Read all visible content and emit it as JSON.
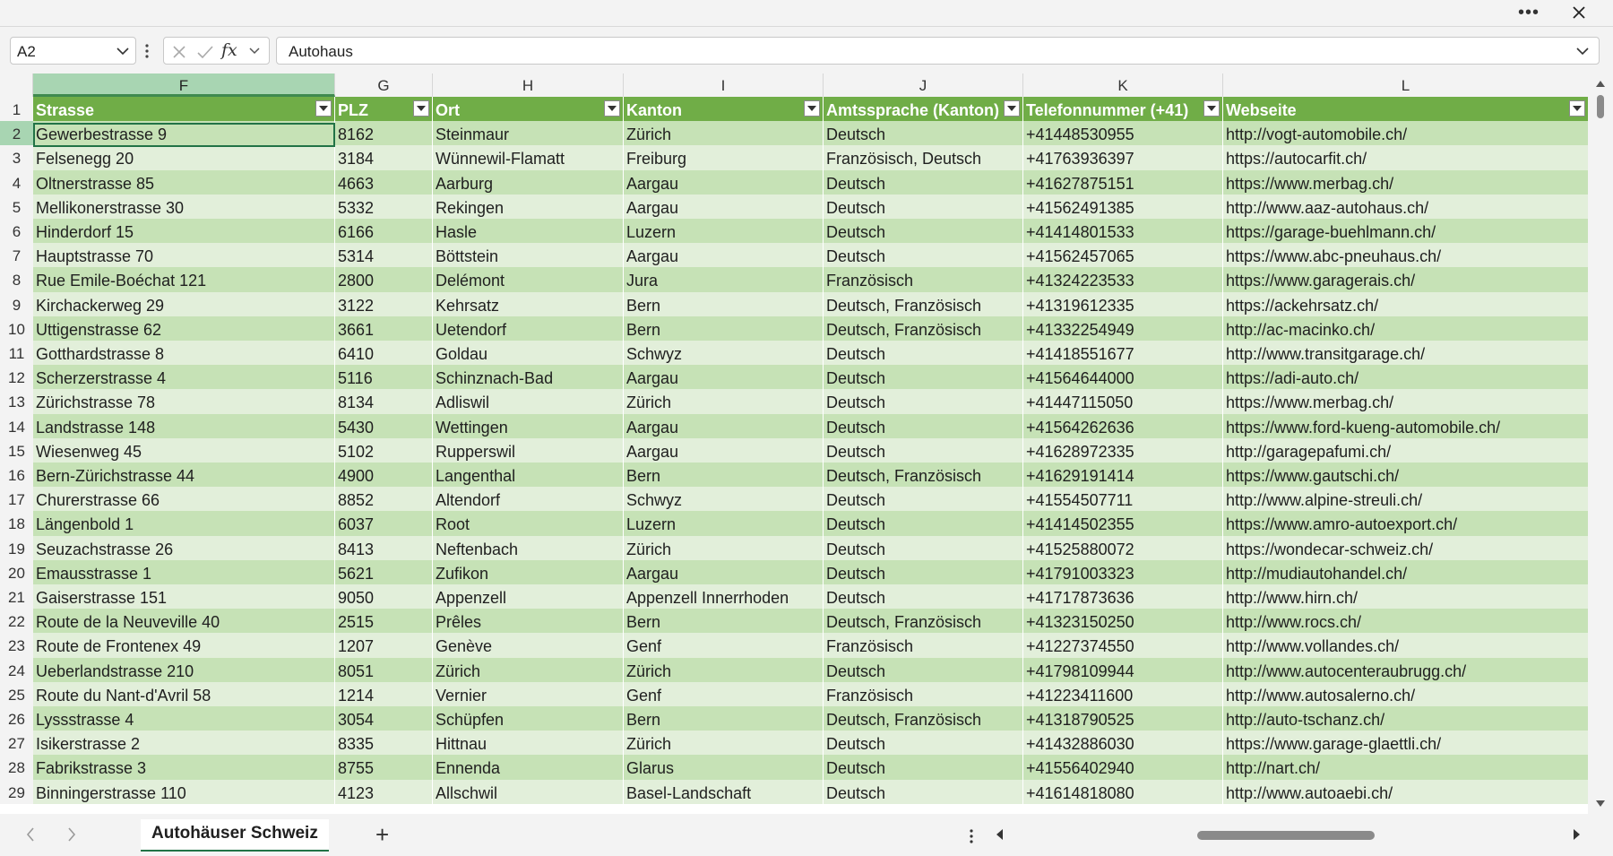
{
  "window": {
    "more_icon": "ellipsis-icon",
    "close_icon": "close-icon"
  },
  "formula_bar": {
    "name_box": "A2",
    "formula": "Autohaus",
    "fx_label": "fx"
  },
  "colors": {
    "header_fill": "#70ad47",
    "band_dark": "#c6e2b6",
    "band_light": "#e2efda",
    "selected_col": "#a8d5b2",
    "accent": "#217346"
  },
  "columns": [
    "F",
    "G",
    "H",
    "I",
    "J",
    "K",
    "L"
  ],
  "selected_column": "F",
  "table": {
    "headers": [
      "Strasse",
      "PLZ",
      "Ort",
      "Kanton",
      "Amtssprache (Kanton)",
      "Telefonnummer (+41)",
      "Webseite"
    ],
    "rows": [
      [
        "Gewerbestrasse 9",
        "8162",
        "Steinmaur",
        "Zürich",
        "Deutsch",
        "+41448530955",
        "http://vogt-automobile.ch/"
      ],
      [
        "Felsenegg 20",
        "3184",
        "Wünnewil-Flamatt",
        "Freiburg",
        "Französisch, Deutsch",
        "+41763936397",
        "https://autocarfit.ch/"
      ],
      [
        "Oltnerstrasse 85",
        "4663",
        "Aarburg",
        "Aargau",
        "Deutsch",
        "+41627875151",
        "https://www.merbag.ch/"
      ],
      [
        "Mellikonerstrasse 30",
        "5332",
        "Rekingen",
        "Aargau",
        "Deutsch",
        "+41562491385",
        "http://www.aaz-autohaus.ch/"
      ],
      [
        "Hinderdorf 15",
        "6166",
        "Hasle",
        "Luzern",
        "Deutsch",
        "+41414801533",
        "https://garage-buehlmann.ch/"
      ],
      [
        "Hauptstrasse 70",
        "5314",
        "Böttstein",
        "Aargau",
        "Deutsch",
        "+41562457065",
        "https://www.abc-pneuhaus.ch/"
      ],
      [
        "Rue Emile-Boéchat 121",
        "2800",
        "Delémont",
        "Jura",
        "Französisch",
        "+41324223533",
        "https://www.garagerais.ch/"
      ],
      [
        "Kirchackerweg 29",
        "3122",
        "Kehrsatz",
        "Bern",
        "Deutsch, Französisch",
        "+41319612335",
        "https://ackehrsatz.ch/"
      ],
      [
        "Uttigenstrasse 62",
        "3661",
        "Uetendorf",
        "Bern",
        "Deutsch, Französisch",
        "+41332254949",
        "http://ac-macinko.ch/"
      ],
      [
        "Gotthardstrasse 8",
        "6410",
        "Goldau",
        "Schwyz",
        "Deutsch",
        "+41418551677",
        "http://www.transitgarage.ch/"
      ],
      [
        "Scherzerstrasse 4",
        "5116",
        "Schinznach-Bad",
        "Aargau",
        "Deutsch",
        "+41564644000",
        "https://adi-auto.ch/"
      ],
      [
        "Zürichstrasse 78",
        "8134",
        "Adliswil",
        "Zürich",
        "Deutsch",
        "+41447115050",
        "https://www.merbag.ch/"
      ],
      [
        "Landstrasse 148",
        "5430",
        "Wettingen",
        "Aargau",
        "Deutsch",
        "+41564262636",
        "https://www.ford-kueng-automobile.ch/"
      ],
      [
        "Wiesenweg 45",
        "5102",
        "Rupperswil",
        "Aargau",
        "Deutsch",
        "+41628972335",
        "http://garagepafumi.ch/"
      ],
      [
        "Bern-Zürichstrasse 44",
        "4900",
        "Langenthal",
        "Bern",
        "Deutsch, Französisch",
        "+41629191414",
        "https://www.gautschi.ch/"
      ],
      [
        "Churerstrasse 66",
        "8852",
        "Altendorf",
        "Schwyz",
        "Deutsch",
        "+41554507711",
        "http://www.alpine-streuli.ch/"
      ],
      [
        "Längenbold 1",
        "6037",
        "Root",
        "Luzern",
        "Deutsch",
        "+41414502355",
        "https://www.amro-autoexport.ch/"
      ],
      [
        "Seuzachstrasse 26",
        "8413",
        "Neftenbach",
        "Zürich",
        "Deutsch",
        "+41525880072",
        "https://wondecar-schweiz.ch/"
      ],
      [
        "Emausstrasse 1",
        "5621",
        "Zufikon",
        "Aargau",
        "Deutsch",
        "+41791003323",
        "http://mudiautohandel.ch/"
      ],
      [
        "Gaiserstrasse 151",
        "9050",
        "Appenzell",
        "Appenzell Innerrhoden",
        "Deutsch",
        "+41717873636",
        "http://www.hirn.ch/"
      ],
      [
        "Route de la Neuveville 40",
        "2515",
        "Prêles",
        "Bern",
        "Deutsch, Französisch",
        "+41323150250",
        "http://www.rocs.ch/"
      ],
      [
        "Route de Frontenex 49",
        "1207",
        "Genève",
        "Genf",
        "Französisch",
        "+41227374550",
        "http://www.vollandes.ch/"
      ],
      [
        "Ueberlandstrasse 210",
        "8051",
        "Zürich",
        "Zürich",
        "Deutsch",
        "+41798109944",
        "http://www.autocenteraubrugg.ch/"
      ],
      [
        "Route du Nant-d'Avril 58",
        "1214",
        "Vernier",
        "Genf",
        "Französisch",
        "+41223411600",
        "http://www.autosalerno.ch/"
      ],
      [
        "Lyssstrasse 4",
        "3054",
        "Schüpfen",
        "Bern",
        "Deutsch, Französisch",
        "+41318790525",
        "http://auto-tschanz.ch/"
      ],
      [
        "Isikerstrasse 2",
        "8335",
        "Hittnau",
        "Zürich",
        "Deutsch",
        "+41432886030",
        "https://www.garage-glaettli.ch/"
      ],
      [
        "Fabrikstrasse 3",
        "8755",
        "Ennenda",
        "Glarus",
        "Deutsch",
        "+41556402940",
        "http://nart.ch/"
      ],
      [
        "Binningerstrasse 110",
        "4123",
        "Allschwil",
        "Basel-Landschaft",
        "Deutsch",
        "+41614818080",
        "http://www.autoaebi.ch/"
      ]
    ]
  },
  "sheet_tabs": [
    "Autohäuser Schweiz"
  ],
  "add_sheet_label": "+"
}
